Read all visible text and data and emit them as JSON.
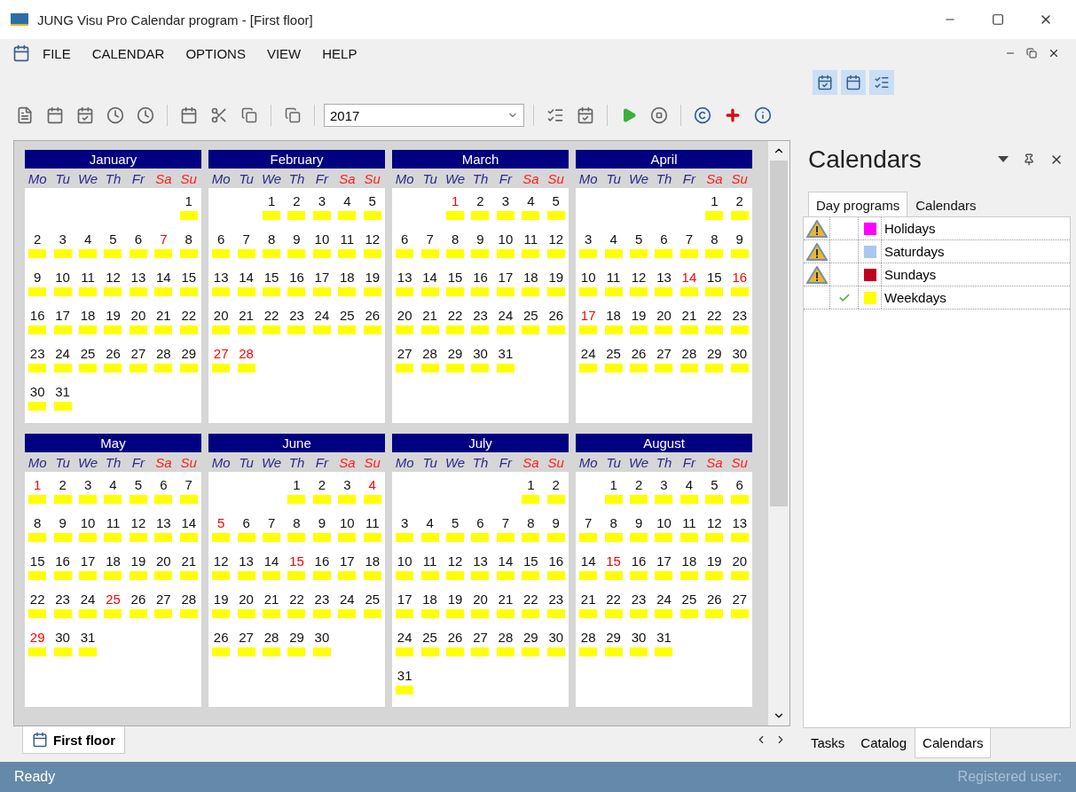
{
  "window": {
    "title": "JUNG Visu Pro Calendar program - [First floor]"
  },
  "menu": [
    "FILE",
    "CALENDAR",
    "OPTIONS",
    "VIEW",
    "HELP"
  ],
  "toolbar": {
    "year": "2017"
  },
  "months": [
    {
      "name": "January",
      "weekdays": [
        {
          "label": "Mo",
          "weekend": false
        },
        {
          "label": "Tu",
          "weekend": false
        },
        {
          "label": "We",
          "weekend": false
        },
        {
          "label": "Th",
          "weekend": false
        },
        {
          "label": "Fr",
          "weekend": false
        },
        {
          "label": "Sa",
          "weekend": true
        },
        {
          "label": "Su",
          "weekend": true
        }
      ],
      "days": [
        {
          "kind": "blank"
        },
        {
          "kind": "blank"
        },
        {
          "kind": "blank"
        },
        {
          "kind": "blank"
        },
        {
          "kind": "blank"
        },
        {
          "kind": "blank"
        },
        {
          "day": "1",
          "holiday": false
        },
        {
          "day": "2",
          "holiday": false
        },
        {
          "day": "3",
          "holiday": false
        },
        {
          "day": "4",
          "holiday": false
        },
        {
          "day": "5",
          "holiday": false
        },
        {
          "day": "6",
          "holiday": false
        },
        {
          "day": "7",
          "holiday": true
        },
        {
          "day": "8",
          "holiday": false
        },
        {
          "day": "9",
          "holiday": false
        },
        {
          "day": "10",
          "holiday": false
        },
        {
          "day": "11",
          "holiday": false
        },
        {
          "day": "12",
          "holiday": false
        },
        {
          "day": "13",
          "holiday": false
        },
        {
          "day": "14",
          "holiday": false
        },
        {
          "day": "15",
          "holiday": false
        },
        {
          "day": "16",
          "holiday": false
        },
        {
          "day": "17",
          "holiday": false
        },
        {
          "day": "18",
          "holiday": false
        },
        {
          "day": "19",
          "holiday": false
        },
        {
          "day": "20",
          "holiday": false
        },
        {
          "day": "21",
          "holiday": false
        },
        {
          "day": "22",
          "holiday": false
        },
        {
          "day": "23",
          "holiday": false
        },
        {
          "day": "24",
          "holiday": false
        },
        {
          "day": "25",
          "holiday": false
        },
        {
          "day": "26",
          "holiday": false
        },
        {
          "day": "27",
          "holiday": false
        },
        {
          "day": "28",
          "holiday": false
        },
        {
          "day": "29",
          "holiday": false
        },
        {
          "day": "30",
          "holiday": false
        },
        {
          "day": "31",
          "holiday": false
        }
      ]
    },
    {
      "name": "February",
      "weekdays": [
        {
          "label": "Mo",
          "weekend": false
        },
        {
          "label": "Tu",
          "weekend": false
        },
        {
          "label": "We",
          "weekend": false
        },
        {
          "label": "Th",
          "weekend": false
        },
        {
          "label": "Fr",
          "weekend": false
        },
        {
          "label": "Sa",
          "weekend": true
        },
        {
          "label": "Su",
          "weekend": true
        }
      ],
      "days": [
        {
          "kind": "blank"
        },
        {
          "kind": "blank"
        },
        {
          "day": "1",
          "holiday": false
        },
        {
          "day": "2",
          "holiday": false
        },
        {
          "day": "3",
          "holiday": false
        },
        {
          "day": "4",
          "holiday": false
        },
        {
          "day": "5",
          "holiday": false
        },
        {
          "day": "6",
          "holiday": false
        },
        {
          "day": "7",
          "holiday": false
        },
        {
          "day": "8",
          "holiday": false
        },
        {
          "day": "9",
          "holiday": false
        },
        {
          "day": "10",
          "holiday": false
        },
        {
          "day": "11",
          "holiday": false
        },
        {
          "day": "12",
          "holiday": false
        },
        {
          "day": "13",
          "holiday": false
        },
        {
          "day": "14",
          "holiday": false
        },
        {
          "day": "15",
          "holiday": false
        },
        {
          "day": "16",
          "holiday": false
        },
        {
          "day": "17",
          "holiday": false
        },
        {
          "day": "18",
          "holiday": false
        },
        {
          "day": "19",
          "holiday": false
        },
        {
          "day": "20",
          "holiday": false
        },
        {
          "day": "21",
          "holiday": false
        },
        {
          "day": "22",
          "holiday": false
        },
        {
          "day": "23",
          "holiday": false
        },
        {
          "day": "24",
          "holiday": false
        },
        {
          "day": "25",
          "holiday": false
        },
        {
          "day": "26",
          "holiday": false
        },
        {
          "day": "27",
          "holiday": true
        },
        {
          "day": "28",
          "holiday": true
        }
      ]
    },
    {
      "name": "March",
      "weekdays": [
        {
          "label": "Mo",
          "weekend": false
        },
        {
          "label": "Tu",
          "weekend": false
        },
        {
          "label": "We",
          "weekend": false
        },
        {
          "label": "Th",
          "weekend": false
        },
        {
          "label": "Fr",
          "weekend": false
        },
        {
          "label": "Sa",
          "weekend": true
        },
        {
          "label": "Su",
          "weekend": true
        }
      ],
      "days": [
        {
          "kind": "blank"
        },
        {
          "kind": "blank"
        },
        {
          "day": "1",
          "holiday": true
        },
        {
          "day": "2",
          "holiday": false
        },
        {
          "day": "3",
          "holiday": false
        },
        {
          "day": "4",
          "holiday": false
        },
        {
          "day": "5",
          "holiday": false
        },
        {
          "day": "6",
          "holiday": false
        },
        {
          "day": "7",
          "holiday": false
        },
        {
          "day": "8",
          "holiday": false
        },
        {
          "day": "9",
          "holiday": false
        },
        {
          "day": "10",
          "holiday": false
        },
        {
          "day": "11",
          "holiday": false
        },
        {
          "day": "12",
          "holiday": false
        },
        {
          "day": "13",
          "holiday": false
        },
        {
          "day": "14",
          "holiday": false
        },
        {
          "day": "15",
          "holiday": false
        },
        {
          "day": "16",
          "holiday": false
        },
        {
          "day": "17",
          "holiday": false
        },
        {
          "day": "18",
          "holiday": false
        },
        {
          "day": "19",
          "holiday": false
        },
        {
          "day": "20",
          "holiday": false
        },
        {
          "day": "21",
          "holiday": false
        },
        {
          "day": "22",
          "holiday": false
        },
        {
          "day": "23",
          "holiday": false
        },
        {
          "day": "24",
          "holiday": false
        },
        {
          "day": "25",
          "holiday": false
        },
        {
          "day": "26",
          "holiday": false
        },
        {
          "day": "27",
          "holiday": false
        },
        {
          "day": "28",
          "holiday": false
        },
        {
          "day": "29",
          "holiday": false
        },
        {
          "day": "30",
          "holiday": false
        },
        {
          "day": "31",
          "holiday": false
        }
      ]
    },
    {
      "name": "April",
      "weekdays": [
        {
          "label": "Mo",
          "weekend": false
        },
        {
          "label": "Tu",
          "weekend": false
        },
        {
          "label": "We",
          "weekend": false
        },
        {
          "label": "Th",
          "weekend": false
        },
        {
          "label": "Fr",
          "weekend": false
        },
        {
          "label": "Sa",
          "weekend": true
        },
        {
          "label": "Su",
          "weekend": true
        }
      ],
      "days": [
        {
          "kind": "blank"
        },
        {
          "kind": "blank"
        },
        {
          "kind": "blank"
        },
        {
          "kind": "blank"
        },
        {
          "kind": "blank"
        },
        {
          "day": "1",
          "holiday": false
        },
        {
          "day": "2",
          "holiday": false
        },
        {
          "day": "3",
          "holiday": false
        },
        {
          "day": "4",
          "holiday": false
        },
        {
          "day": "5",
          "holiday": false
        },
        {
          "day": "6",
          "holiday": false
        },
        {
          "day": "7",
          "holiday": false
        },
        {
          "day": "8",
          "holiday": false
        },
        {
          "day": "9",
          "holiday": false
        },
        {
          "day": "10",
          "holiday": false
        },
        {
          "day": "11",
          "holiday": false
        },
        {
          "day": "12",
          "holiday": false
        },
        {
          "day": "13",
          "holiday": false
        },
        {
          "day": "14",
          "holiday": true
        },
        {
          "day": "15",
          "holiday": false
        },
        {
          "day": "16",
          "holiday": true
        },
        {
          "day": "17",
          "holiday": true
        },
        {
          "day": "18",
          "holiday": false
        },
        {
          "day": "19",
          "holiday": false
        },
        {
          "day": "20",
          "holiday": false
        },
        {
          "day": "21",
          "holiday": false
        },
        {
          "day": "22",
          "holiday": false
        },
        {
          "day": "23",
          "holiday": false
        },
        {
          "day": "24",
          "holiday": false
        },
        {
          "day": "25",
          "holiday": false
        },
        {
          "day": "26",
          "holiday": false
        },
        {
          "day": "27",
          "holiday": false
        },
        {
          "day": "28",
          "holiday": false
        },
        {
          "day": "29",
          "holiday": false
        },
        {
          "day": "30",
          "holiday": false
        }
      ]
    },
    {
      "name": "May",
      "weekdays": [
        {
          "label": "Mo",
          "weekend": false
        },
        {
          "label": "Tu",
          "weekend": false
        },
        {
          "label": "We",
          "weekend": false
        },
        {
          "label": "Th",
          "weekend": false
        },
        {
          "label": "Fr",
          "weekend": false
        },
        {
          "label": "Sa",
          "weekend": true
        },
        {
          "label": "Su",
          "weekend": true
        }
      ],
      "days": [
        {
          "day": "1",
          "holiday": true
        },
        {
          "day": "2",
          "holiday": false
        },
        {
          "day": "3",
          "holiday": false
        },
        {
          "day": "4",
          "holiday": false
        },
        {
          "day": "5",
          "holiday": false
        },
        {
          "day": "6",
          "holiday": false
        },
        {
          "day": "7",
          "holiday": false
        },
        {
          "day": "8",
          "holiday": false
        },
        {
          "day": "9",
          "holiday": false
        },
        {
          "day": "10",
          "holiday": false
        },
        {
          "day": "11",
          "holiday": false
        },
        {
          "day": "12",
          "holiday": false
        },
        {
          "day": "13",
          "holiday": false
        },
        {
          "day": "14",
          "holiday": false
        },
        {
          "day": "15",
          "holiday": false
        },
        {
          "day": "16",
          "holiday": false
        },
        {
          "day": "17",
          "holiday": false
        },
        {
          "day": "18",
          "holiday": false
        },
        {
          "day": "19",
          "holiday": false
        },
        {
          "day": "20",
          "holiday": false
        },
        {
          "day": "21",
          "holiday": false
        },
        {
          "day": "22",
          "holiday": false
        },
        {
          "day": "23",
          "holiday": false
        },
        {
          "day": "24",
          "holiday": false
        },
        {
          "day": "25",
          "holiday": true
        },
        {
          "day": "26",
          "holiday": false
        },
        {
          "day": "27",
          "holiday": false
        },
        {
          "day": "28",
          "holiday": false
        },
        {
          "day": "29",
          "holiday": true
        },
        {
          "day": "30",
          "holiday": false
        },
        {
          "day": "31",
          "holiday": false
        }
      ]
    },
    {
      "name": "June",
      "weekdays": [
        {
          "label": "Mo",
          "weekend": false
        },
        {
          "label": "Tu",
          "weekend": false
        },
        {
          "label": "We",
          "weekend": false
        },
        {
          "label": "Th",
          "weekend": false
        },
        {
          "label": "Fr",
          "weekend": false
        },
        {
          "label": "Sa",
          "weekend": true
        },
        {
          "label": "Su",
          "weekend": true
        }
      ],
      "days": [
        {
          "kind": "blank"
        },
        {
          "kind": "blank"
        },
        {
          "kind": "blank"
        },
        {
          "day": "1",
          "holiday": false
        },
        {
          "day": "2",
          "holiday": false
        },
        {
          "day": "3",
          "holiday": false
        },
        {
          "day": "4",
          "holiday": true
        },
        {
          "day": "5",
          "holiday": true
        },
        {
          "day": "6",
          "holiday": false
        },
        {
          "day": "7",
          "holiday": false
        },
        {
          "day": "8",
          "holiday": false
        },
        {
          "day": "9",
          "holiday": false
        },
        {
          "day": "10",
          "holiday": false
        },
        {
          "day": "11",
          "holiday": false
        },
        {
          "day": "12",
          "holiday": false
        },
        {
          "day": "13",
          "holiday": false
        },
        {
          "day": "14",
          "holiday": false
        },
        {
          "day": "15",
          "holiday": true
        },
        {
          "day": "16",
          "holiday": false
        },
        {
          "day": "17",
          "holiday": false
        },
        {
          "day": "18",
          "holiday": false
        },
        {
          "day": "19",
          "holiday": false
        },
        {
          "day": "20",
          "holiday": false
        },
        {
          "day": "21",
          "holiday": false
        },
        {
          "day": "22",
          "holiday": false
        },
        {
          "day": "23",
          "holiday": false
        },
        {
          "day": "24",
          "holiday": false
        },
        {
          "day": "25",
          "holiday": false
        },
        {
          "day": "26",
          "holiday": false
        },
        {
          "day": "27",
          "holiday": false
        },
        {
          "day": "28",
          "holiday": false
        },
        {
          "day": "29",
          "holiday": false
        },
        {
          "day": "30",
          "holiday": false
        }
      ]
    },
    {
      "name": "July",
      "weekdays": [
        {
          "label": "Mo",
          "weekend": false
        },
        {
          "label": "Tu",
          "weekend": false
        },
        {
          "label": "We",
          "weekend": false
        },
        {
          "label": "Th",
          "weekend": false
        },
        {
          "label": "Fr",
          "weekend": false
        },
        {
          "label": "Sa",
          "weekend": true
        },
        {
          "label": "Su",
          "weekend": true
        }
      ],
      "days": [
        {
          "kind": "blank"
        },
        {
          "kind": "blank"
        },
        {
          "kind": "blank"
        },
        {
          "kind": "blank"
        },
        {
          "kind": "blank"
        },
        {
          "day": "1",
          "holiday": false
        },
        {
          "day": "2",
          "holiday": false
        },
        {
          "day": "3",
          "holiday": false
        },
        {
          "day": "4",
          "holiday": false
        },
        {
          "day": "5",
          "holiday": false
        },
        {
          "day": "6",
          "holiday": false
        },
        {
          "day": "7",
          "holiday": false
        },
        {
          "day": "8",
          "holiday": false
        },
        {
          "day": "9",
          "holiday": false
        },
        {
          "day": "10",
          "holiday": false
        },
        {
          "day": "11",
          "holiday": false
        },
        {
          "day": "12",
          "holiday": false
        },
        {
          "day": "13",
          "holiday": false
        },
        {
          "day": "14",
          "holiday": false
        },
        {
          "day": "15",
          "holiday": false
        },
        {
          "day": "16",
          "holiday": false
        },
        {
          "day": "17",
          "holiday": false
        },
        {
          "day": "18",
          "holiday": false
        },
        {
          "day": "19",
          "holiday": false
        },
        {
          "day": "20",
          "holiday": false
        },
        {
          "day": "21",
          "holiday": false
        },
        {
          "day": "22",
          "holiday": false
        },
        {
          "day": "23",
          "holiday": false
        },
        {
          "day": "24",
          "holiday": false
        },
        {
          "day": "25",
          "holiday": false
        },
        {
          "day": "26",
          "holiday": false
        },
        {
          "day": "27",
          "holiday": false
        },
        {
          "day": "28",
          "holiday": false
        },
        {
          "day": "29",
          "holiday": false
        },
        {
          "day": "30",
          "holiday": false
        },
        {
          "day": "31",
          "holiday": false
        }
      ]
    },
    {
      "name": "August",
      "weekdays": [
        {
          "label": "Mo",
          "weekend": false
        },
        {
          "label": "Tu",
          "weekend": false
        },
        {
          "label": "We",
          "weekend": false
        },
        {
          "label": "Th",
          "weekend": false
        },
        {
          "label": "Fr",
          "weekend": false
        },
        {
          "label": "Sa",
          "weekend": true
        },
        {
          "label": "Su",
          "weekend": true
        }
      ],
      "days": [
        {
          "kind": "blank"
        },
        {
          "day": "1",
          "holiday": false
        },
        {
          "day": "2",
          "holiday": false
        },
        {
          "day": "3",
          "holiday": false
        },
        {
          "day": "4",
          "holiday": false
        },
        {
          "day": "5",
          "holiday": false
        },
        {
          "day": "6",
          "holiday": false
        },
        {
          "day": "7",
          "holiday": false
        },
        {
          "day": "8",
          "holiday": false
        },
        {
          "day": "9",
          "holiday": false
        },
        {
          "day": "10",
          "holiday": false
        },
        {
          "day": "11",
          "holiday": false
        },
        {
          "day": "12",
          "holiday": false
        },
        {
          "day": "13",
          "holiday": false
        },
        {
          "day": "14",
          "holiday": false
        },
        {
          "day": "15",
          "holiday": true
        },
        {
          "day": "16",
          "holiday": false
        },
        {
          "day": "17",
          "holiday": false
        },
        {
          "day": "18",
          "holiday": false
        },
        {
          "day": "19",
          "holiday": false
        },
        {
          "day": "20",
          "holiday": false
        },
        {
          "day": "21",
          "holiday": false
        },
        {
          "day": "22",
          "holiday": false
        },
        {
          "day": "23",
          "holiday": false
        },
        {
          "day": "24",
          "holiday": false
        },
        {
          "day": "25",
          "holiday": false
        },
        {
          "day": "26",
          "holiday": false
        },
        {
          "day": "27",
          "holiday": false
        },
        {
          "day": "28",
          "holiday": false
        },
        {
          "day": "29",
          "holiday": false
        },
        {
          "day": "30",
          "holiday": false
        },
        {
          "day": "31",
          "holiday": false
        }
      ]
    }
  ],
  "document_tab": {
    "label": "First floor"
  },
  "panel": {
    "title": "Calendars",
    "tabs": [
      {
        "label": "Day programs",
        "selected": true
      },
      {
        "label": "Calendars",
        "selected": false
      }
    ],
    "programs": [
      {
        "name": "Holidays",
        "warning": true,
        "checked": false,
        "color": "#ff00ff"
      },
      {
        "name": "Saturdays",
        "warning": true,
        "checked": false,
        "color": "#a8c8f0"
      },
      {
        "name": "Sundays",
        "warning": true,
        "checked": false,
        "color": "#c00020"
      },
      {
        "name": "Weekdays",
        "warning": false,
        "checked": true,
        "color": "#ffff00"
      }
    ],
    "bottom_tabs": [
      {
        "label": "Tasks",
        "selected": false
      },
      {
        "label": "Catalog",
        "selected": false
      },
      {
        "label": "Calendars",
        "selected": true
      }
    ]
  },
  "status_bar": {
    "left": "Ready",
    "right": "Registered user:"
  }
}
